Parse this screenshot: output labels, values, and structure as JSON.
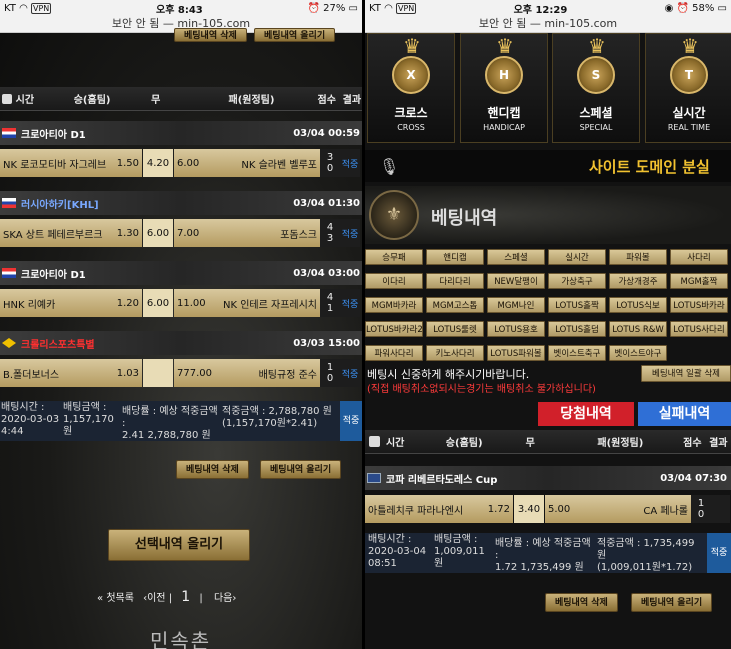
{
  "left": {
    "status": {
      "carrier": "KT",
      "vpn": "VPN",
      "time": "오후 8:43",
      "battery": "27%"
    },
    "url": "보안 안 됨 — min-105.com",
    "top_buttons": [
      "베팅내역 삭제",
      "베팅내역 올리기"
    ],
    "header": {
      "time": "시간",
      "home": "승(홈팀)",
      "draw": "무",
      "away": "패(원정팀)",
      "score": "점수",
      "result": "결과"
    },
    "matches": [
      {
        "league": "크로아티아 D1",
        "league_color": "#ffffff",
        "date": "03/04 00:59",
        "home": "NK 로코모티바 자그레브",
        "home_odds": "1.50",
        "draw": "4.20",
        "away_odds": "6.00",
        "away": "NK 슬라벤 벨루포",
        "score": [
          "3",
          "0"
        ],
        "result": "적중"
      },
      {
        "league": "러시아하키[KHL]",
        "league_color": "#79a8ff",
        "date": "03/04 01:30",
        "home": "SKA 상트 페테르부르크",
        "home_odds": "1.30",
        "draw": "6.00",
        "away_odds": "7.00",
        "away": "포돔스크",
        "score": [
          "4",
          "3"
        ],
        "result": "적중"
      },
      {
        "league": "크로아티아 D1",
        "league_color": "#ffffff",
        "date": "03/04 03:00",
        "home": "HNK 리예카",
        "home_odds": "1.20",
        "draw": "6.00",
        "away_odds": "11.00",
        "away": "NK 인테르 자프레시치",
        "score": [
          "4",
          "1"
        ],
        "result": "적중"
      },
      {
        "league": "크롤리스포츠특별",
        "league_color": "#ff3030",
        "date": "03/03 15:00",
        "home": "B.폴더보너스",
        "home_odds": "1.03",
        "draw": "",
        "away_odds": "777.00",
        "away": "배팅규정 준수",
        "score": [
          "1",
          "0"
        ],
        "result": "적중"
      }
    ],
    "summary": {
      "time_label": "배팅시간 :",
      "date": "2020-03-03",
      "clock": "4:44",
      "amount_label": "배팅금액 :",
      "amount": "1,157,170",
      "amount_unit": "원",
      "odds_label": "배당률 :",
      "odds": "2.41",
      "expected_label": "예상 적중금액 :",
      "expected": "2,788,780 원",
      "hit_label": "적중금액 :",
      "hit": "2,788,780 원",
      "hit_calc": "(1,157,170원*2.41)",
      "status": "적중"
    },
    "bottom_buttons": [
      "베팅내역 삭제",
      "베팅내역 올리기"
    ],
    "select_button": "선택내역 올리기",
    "pager": {
      "first": "첫목록",
      "prev": "이전",
      "page": "1",
      "next": "다음"
    },
    "footer_logo": "민속촌"
  },
  "right": {
    "status": {
      "carrier": "KT",
      "vpn": "VPN",
      "time": "오후 12:29",
      "battery": "58%"
    },
    "url": "보안 안 됨 — min-105.com",
    "tiles": [
      {
        "letter": "X",
        "ko": "크로스",
        "en": "CROSS"
      },
      {
        "letter": "H",
        "ko": "핸디캡",
        "en": "HANDICAP"
      },
      {
        "letter": "S",
        "ko": "스페셜",
        "en": "SPECIAL"
      },
      {
        "letter": "T",
        "ko": "실시간",
        "en": "REAL TIME"
      }
    ],
    "banner": "사이트 도메인 분실",
    "section_title": "베팅내역",
    "filters": [
      "승무패",
      "핸디캡",
      "스페셜",
      "실시간",
      "파워볼",
      "사다리",
      "이다리",
      "다리다리",
      "NEW달팽이",
      "가상축구",
      "가상개경주",
      "MGM홀짝",
      "MGM바카라",
      "MGM고스톱",
      "MGM나인",
      "LOTUS홀짝",
      "LOTUS식보",
      "LOTUS바카라",
      "LOTUS바카라2",
      "LOTUS룰렛",
      "LOTUS용호",
      "LOTUS홀덤",
      "LOTUS R&W",
      "LOTUS사다리",
      "파워사다리",
      "키노사다리",
      "LOTUS파워볼",
      "벳이스트축구",
      "벳이스트야구"
    ],
    "notice1": "베팅시 신중하게 해주시기바랍니다.",
    "notice2": "(직접 배팅취소없되시는경기는 배팅취소 불가하십니다)",
    "delete_all": "베팅내역 일괄 삭제",
    "win_tab": "당첨내역",
    "lose_tab": "실패내역",
    "header": {
      "time": "시간",
      "home": "승(홈팀)",
      "draw": "무",
      "away": "패(원정팀)",
      "score": "점수",
      "result": "결과"
    },
    "match": {
      "league": "코파 리베르타도레스 Cup",
      "date": "03/04 07:30",
      "home": "아틀레치쿠 파라나엔시",
      "home_odds": "1.72",
      "draw": "3.40",
      "away_odds": "5.00",
      "away": "CA 페나롤",
      "score": [
        "1",
        "0"
      ]
    },
    "summary": {
      "time_label": "배팅시간 :",
      "date": "2020-03-04",
      "clock": "08:51",
      "amount_label": "배팅금액 :",
      "amount": "1,009,011",
      "amount_unit": "원",
      "odds_label": "배당률 :",
      "odds": "1.72",
      "expected_label": "예상 적중금액 :",
      "expected": "1,735,499 원",
      "hit_label": "적중금액 :",
      "hit": "1,735,499 원",
      "hit_calc": "(1,009,011원*1.72)",
      "status": "적중"
    },
    "bottom_buttons": [
      "베팅내역 삭제",
      "베팅내역 올리기"
    ]
  }
}
